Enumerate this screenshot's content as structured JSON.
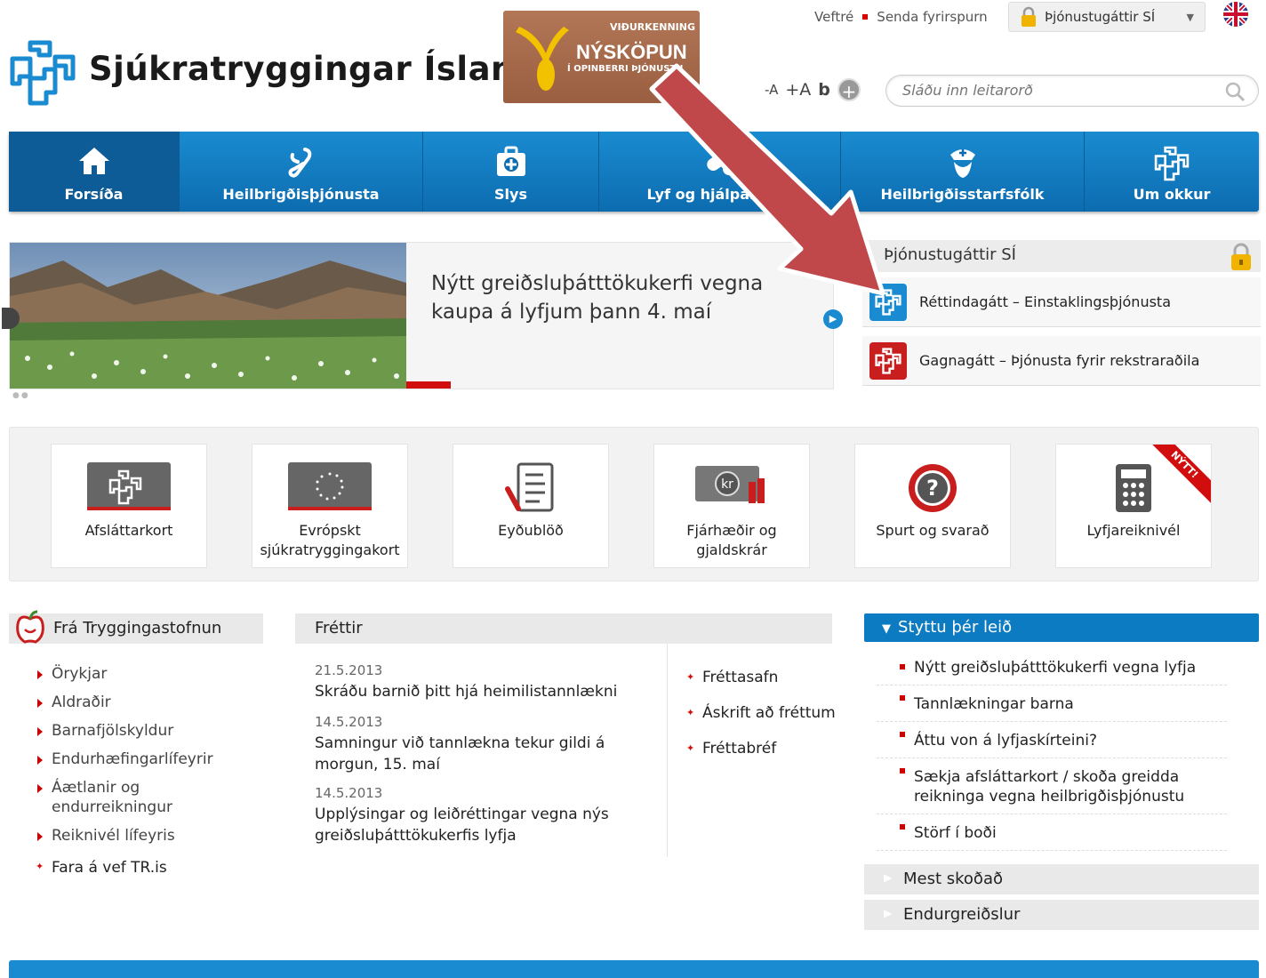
{
  "header": {
    "org_name": "Sjúkratryggingar Íslands",
    "award": {
      "line1": "VIÐURKENNING",
      "line2": "NÝSKÖPUN",
      "line3": "Í OPINBERRI ÞJÓNUSTU"
    },
    "top_links": {
      "sitemap": "Veftré",
      "send_question": "Senda fyrirspurn"
    },
    "portal_dropdown": "Þjónustugáttir SÍ",
    "text_tools": {
      "smaller": "-A",
      "larger": "+A",
      "bold": "b"
    },
    "search": {
      "placeholder": "Sláðu inn leitarorð"
    }
  },
  "nav": [
    {
      "label": "Forsíða",
      "icon": "home-icon"
    },
    {
      "label": "Heilbrigðisþjónusta",
      "icon": "health-service-icon"
    },
    {
      "label": "Slys",
      "icon": "first-aid-kit-icon"
    },
    {
      "label": "Lyf og hjálpartæki",
      "icon": "medicine-icon"
    },
    {
      "label": "Heilbrigðisstarfsfólk",
      "icon": "nurse-icon"
    },
    {
      "label": "Um okkur",
      "icon": "logo-icon"
    }
  ],
  "hero": {
    "title": "Nýtt greiðsluþátttökukerfi vegna kaupa á lyfjum þann 4. maí"
  },
  "portals": {
    "title": "Þjónustugáttir SÍ",
    "rows": [
      {
        "label": "Réttindagátt – Einstaklingsþjónusta",
        "color": "#1a8bd0"
      },
      {
        "label": "Gagnagátt – Þjónusta fyrir rekstraraðila",
        "color": "#c81e1e"
      }
    ]
  },
  "tiles": [
    {
      "label": "Afsláttarkort"
    },
    {
      "label": "Evrópskt sjúkratryggingakort"
    },
    {
      "label": "Eyðublöð"
    },
    {
      "label": "Fjárhæðir og gjaldskrár"
    },
    {
      "label": "Spurt og svarað"
    },
    {
      "label": "Lyfjareiknivél",
      "ribbon": "NÝTT!"
    }
  ],
  "tr": {
    "title": "Frá Tryggingastofnun",
    "items": [
      "Örykjar",
      "Aldraðir",
      "Barnafjölskyldur",
      "Endurhæfingarlífeyrir",
      "Áætlanir og endurreikningur",
      "Reiknivél lífeyris"
    ],
    "link": "Fara á vef TR.is"
  },
  "news": {
    "title": "Fréttir",
    "items": [
      {
        "date": "21.5.2013",
        "text": "Skráðu barnið þitt hjá heimilistannlækni"
      },
      {
        "date": "14.5.2013",
        "text": "Samningur við tannlækna tekur gildi á morgun, 15. maí"
      },
      {
        "date": "14.5.2013",
        "text": "Upplýsingar og leiðréttingar vegna nýs greiðsluþátttökukerfis lyfja"
      }
    ],
    "links": [
      "Fréttasafn",
      "Áskrift að fréttum",
      "Fréttabréf"
    ]
  },
  "shortcuts": {
    "title": "Styttu þér leið",
    "items": [
      "Nýtt greiðsluþátttökukerfi vegna lyfja",
      "Tannlækningar barna",
      "Áttu von á lyfjaskírteini?",
      "Sækja afsláttarkort / skoða greidda reikninga vegna heilbrigðisþjónustu",
      "Störf í boði"
    ],
    "collapsed": [
      "Mest skoðað",
      "Endurgreiðslur"
    ]
  },
  "colors": {
    "brand_blue": "#1a8bd0",
    "accent_red": "#d10d0d"
  }
}
